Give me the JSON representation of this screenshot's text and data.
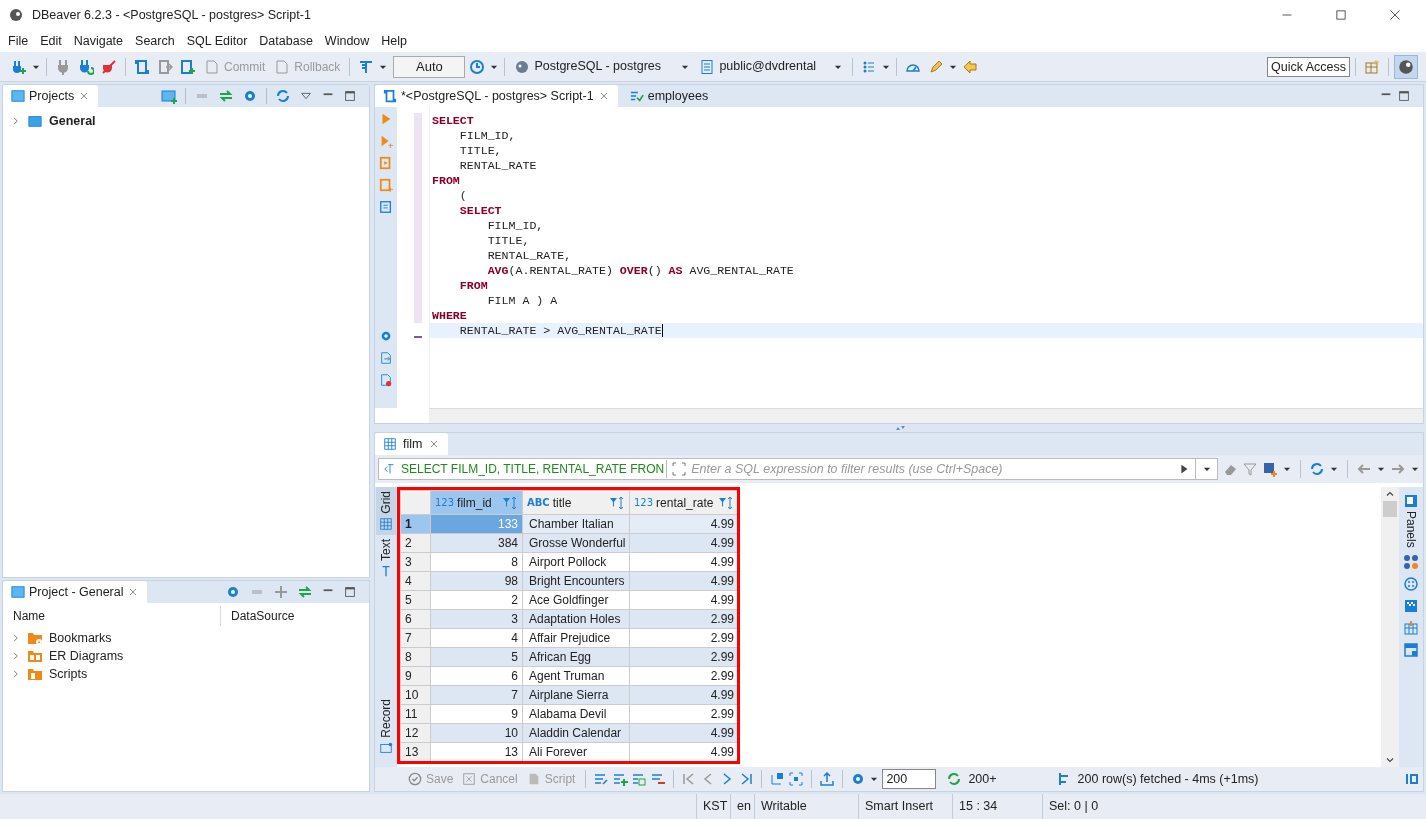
{
  "window": {
    "title": "DBeaver 6.2.3 - <PostgreSQL - postgres> Script-1"
  },
  "menu": [
    "File",
    "Edit",
    "Navigate",
    "Search",
    "SQL Editor",
    "Database",
    "Window",
    "Help"
  ],
  "toolbar": {
    "actions": [
      {
        "label": "Commit",
        "disabled": true
      },
      {
        "label": "Rollback",
        "disabled": true
      }
    ],
    "transaction_mode": "Auto",
    "connection": "PostgreSQL - postgres",
    "schema": "public@dvdrental",
    "quick_access": "Quick Access"
  },
  "projects_panel": {
    "title": "Projects",
    "items": [
      "General"
    ]
  },
  "project_panel": {
    "title": "Project - General",
    "columns": [
      "Name",
      "DataSource"
    ],
    "items": [
      {
        "label": "Bookmarks",
        "kind": "bookmarks"
      },
      {
        "label": "ER Diagrams",
        "kind": "diagrams"
      },
      {
        "label": "Scripts",
        "kind": "scripts"
      }
    ]
  },
  "editor": {
    "tabs": [
      {
        "label": "*<PostgreSQL - postgres> Script-1",
        "selected": true
      },
      {
        "label": "employees",
        "selected": false
      }
    ],
    "lines": [
      {
        "current": false,
        "tokens": [
          {
            "text": "SELECT",
            "kind": "keyword"
          }
        ]
      },
      {
        "current": false,
        "tokens": [
          {
            "text": "    FILM_ID,",
            "kind": "plain"
          }
        ]
      },
      {
        "current": false,
        "tokens": [
          {
            "text": "    TITLE,",
            "kind": "plain"
          }
        ]
      },
      {
        "current": false,
        "tokens": [
          {
            "text": "    RENTAL_RATE",
            "kind": "plain"
          }
        ]
      },
      {
        "current": false,
        "tokens": [
          {
            "text": "FROM",
            "kind": "keyword"
          }
        ]
      },
      {
        "current": false,
        "tokens": [
          {
            "text": "    (",
            "kind": "plain"
          }
        ]
      },
      {
        "current": false,
        "tokens": [
          {
            "text": "    SELECT",
            "kind": "keyword"
          }
        ]
      },
      {
        "current": false,
        "tokens": [
          {
            "text": "        FILM_ID,",
            "kind": "plain"
          }
        ]
      },
      {
        "current": false,
        "tokens": [
          {
            "text": "        TITLE,",
            "kind": "plain"
          }
        ]
      },
      {
        "current": false,
        "tokens": [
          {
            "text": "        RENTAL_RATE,",
            "kind": "plain"
          }
        ]
      },
      {
        "current": false,
        "tokens": [
          {
            "text": "        AVG",
            "kind": "keyword"
          },
          {
            "text": "(A.RENTAL_RATE) ",
            "kind": "plain"
          },
          {
            "text": "OVER",
            "kind": "keyword"
          },
          {
            "text": "() ",
            "kind": "plain"
          },
          {
            "text": "AS",
            "kind": "keyword"
          },
          {
            "text": " AVG_RENTAL_RATE",
            "kind": "plain"
          }
        ]
      },
      {
        "current": false,
        "tokens": [
          {
            "text": "    FROM",
            "kind": "keyword"
          }
        ]
      },
      {
        "current": false,
        "tokens": [
          {
            "text": "        FILM A ) A",
            "kind": "plain"
          }
        ]
      },
      {
        "current": false,
        "tokens": [
          {
            "text": "WHERE",
            "kind": "keyword"
          }
        ]
      },
      {
        "current": true,
        "tokens": [
          {
            "text": "    RENTAL_RATE > AVG_RENTAL_RATE",
            "kind": "plain"
          }
        ]
      }
    ]
  },
  "results": {
    "tab": "film",
    "query": "SELECT FILM_ID, TITLE, RENTAL_RATE FRON",
    "filter_placeholder": "Enter a SQL expression to filter results (use Ctrl+Space)",
    "view_tabs": [
      {
        "label": "Grid",
        "selected": true
      },
      {
        "label": "Text",
        "selected": false
      },
      {
        "label": "Record",
        "selected": false
      }
    ],
    "columns": [
      {
        "type": "123",
        "name": "film_id"
      },
      {
        "type": "ABC",
        "name": "title"
      },
      {
        "type": "123",
        "name": "rental_rate"
      }
    ],
    "rows": [
      {
        "num": "1",
        "selected": true,
        "cells": [
          "133",
          "Chamber Italian",
          "4.99"
        ]
      },
      {
        "num": "2",
        "selected": false,
        "cells": [
          "384",
          "Grosse Wonderful",
          "4.99"
        ]
      },
      {
        "num": "3",
        "selected": false,
        "cells": [
          "8",
          "Airport Pollock",
          "4.99"
        ]
      },
      {
        "num": "4",
        "selected": false,
        "cells": [
          "98",
          "Bright Encounters",
          "4.99"
        ]
      },
      {
        "num": "5",
        "selected": false,
        "cells": [
          "2",
          "Ace Goldfinger",
          "4.99"
        ]
      },
      {
        "num": "6",
        "selected": false,
        "cells": [
          "3",
          "Adaptation Holes",
          "2.99"
        ]
      },
      {
        "num": "7",
        "selected": false,
        "cells": [
          "4",
          "Affair Prejudice",
          "2.99"
        ]
      },
      {
        "num": "8",
        "selected": false,
        "cells": [
          "5",
          "African Egg",
          "2.99"
        ]
      },
      {
        "num": "9",
        "selected": false,
        "cells": [
          "6",
          "Agent Truman",
          "2.99"
        ]
      },
      {
        "num": "10",
        "selected": false,
        "cells": [
          "7",
          "Airplane Sierra",
          "4.99"
        ]
      },
      {
        "num": "11",
        "selected": false,
        "cells": [
          "9",
          "Alabama Devil",
          "2.99"
        ]
      },
      {
        "num": "12",
        "selected": false,
        "cells": [
          "10",
          "Aladdin Calendar",
          "4.99"
        ]
      },
      {
        "num": "13",
        "selected": false,
        "cells": [
          "13",
          "Ali Forever",
          "4.99"
        ]
      }
    ],
    "side_panel": "Panels",
    "actions": [
      {
        "label": "Save",
        "disabled": true
      },
      {
        "label": "Cancel",
        "disabled": true
      },
      {
        "label": "Script",
        "disabled": true
      }
    ],
    "fetch_size": "200",
    "fetch_more": "200+",
    "summary": "200 row(s) fetched - 4ms (+1ms)"
  },
  "status_bar": [
    "KST",
    "en",
    "Writable",
    "Smart Insert",
    "15 : 34",
    "Sel: 0 | 0"
  ]
}
